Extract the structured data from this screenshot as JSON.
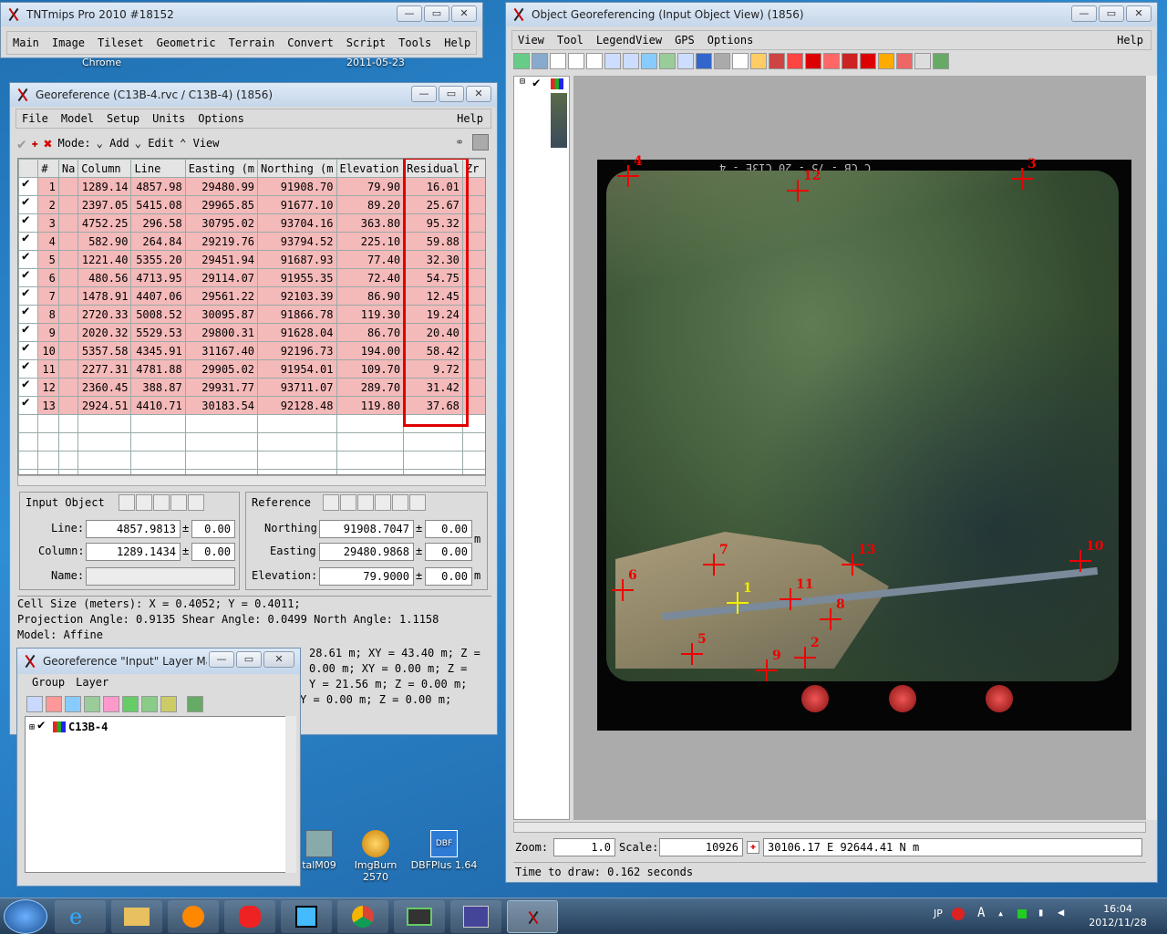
{
  "desktop": {
    "icons": [
      {
        "label": "talM09"
      },
      {
        "label": "ImgBurn 2570"
      },
      {
        "label": "DBFPlus 1.64"
      }
    ],
    "bg_text": [
      "Chrome",
      "2011-05-23"
    ]
  },
  "main_window": {
    "title": "TNTmips Pro 2010  #18152",
    "menus": [
      "Main",
      "Image",
      "Tileset",
      "Geometric",
      "Terrain",
      "Convert",
      "Script",
      "Tools",
      "Help"
    ]
  },
  "georef": {
    "title": "Georeference (C13B-4.rvc / C13B-4) (1856)",
    "menus": [
      "File",
      "Model",
      "Setup",
      "Units",
      "Options"
    ],
    "help": "Help",
    "mode_label": "Mode:",
    "mode_add": "Add",
    "mode_edit": "Edit",
    "mode_view": "View",
    "columns": [
      "#",
      "Na",
      "Column",
      "Line",
      "Easting (m",
      "Northing (m",
      "Elevation",
      "Residual",
      "Zr"
    ],
    "rows": [
      [
        "1",
        "1289.14",
        "4857.98",
        "29480.99",
        "91908.70",
        "79.90",
        "16.01"
      ],
      [
        "2",
        "2397.05",
        "5415.08",
        "29965.85",
        "91677.10",
        "89.20",
        "25.67"
      ],
      [
        "3",
        "4752.25",
        "296.58",
        "30795.02",
        "93704.16",
        "363.80",
        "95.32"
      ],
      [
        "4",
        "582.90",
        "264.84",
        "29219.76",
        "93794.52",
        "225.10",
        "59.88"
      ],
      [
        "5",
        "1221.40",
        "5355.20",
        "29451.94",
        "91687.93",
        "77.40",
        "32.30"
      ],
      [
        "6",
        "480.56",
        "4713.95",
        "29114.07",
        "91955.35",
        "72.40",
        "54.75"
      ],
      [
        "7",
        "1478.91",
        "4407.06",
        "29561.22",
        "92103.39",
        "86.90",
        "12.45"
      ],
      [
        "8",
        "2720.33",
        "5008.52",
        "30095.87",
        "91866.78",
        "119.30",
        "19.24"
      ],
      [
        "9",
        "2020.32",
        "5529.53",
        "29800.31",
        "91628.04",
        "86.70",
        "20.40"
      ],
      [
        "10",
        "5357.58",
        "4345.91",
        "31167.40",
        "92196.73",
        "194.00",
        "58.42"
      ],
      [
        "11",
        "2277.31",
        "4781.88",
        "29905.02",
        "91954.01",
        "109.70",
        "9.72"
      ],
      [
        "12",
        "2360.45",
        "388.87",
        "29931.77",
        "93711.07",
        "289.70",
        "31.42"
      ],
      [
        "13",
        "2924.51",
        "4410.71",
        "30183.54",
        "92128.48",
        "119.80",
        "37.68"
      ]
    ],
    "input": {
      "title": "Input Object",
      "line_label": "Line:",
      "line": "4857.9813",
      "col_label": "Column:",
      "col": "1289.1434",
      "name_label": "Name:",
      "err": "0.00",
      "pm": "±"
    },
    "ref": {
      "title": "Reference",
      "north_label": "Northing",
      "north": "91908.7047",
      "east_label": "Easting",
      "east": "29480.9868",
      "elev_label": "Elevation:",
      "elev": "79.9000",
      "err": "0.00",
      "unit": "m"
    },
    "info": [
      "Cell Size (meters):  X = 0.4052;  Y = 0.4011;",
      "Projection Angle: 0.9135  Shear Angle: 0.0499  North Angle: 1.1158",
      "Model:  Affine"
    ],
    "info_partial": [
      "28.61 m;  XY = 43.40 m;  Z =",
      "0.00 m;  XY = 0.00 m;  Z =",
      "Y = 21.56 m;  Z = 0.00 m;",
      "Y = 0.00 m;  Z = 0.00 m;"
    ]
  },
  "layer_mgr": {
    "title": "Georeference \"Input\" Layer Ma...",
    "menus": [
      "Group",
      "Layer"
    ],
    "layer": "C13B-4"
  },
  "objview": {
    "title": "Object Georeferencing (Input Object View) (1856)",
    "menus": [
      "View",
      "Tool",
      "LegendView",
      "GPS",
      "Options"
    ],
    "help": "Help",
    "photo_text": "C CB - 75 - 20     C13E - 4",
    "zoom_label": "Zoom:",
    "zoom": "1.0",
    "scale_label": "Scale:",
    "scale": "10926",
    "coords": "30106.17 E   92644.41 N m",
    "status": "Time to draw: 0.162 seconds",
    "gcp_labels": [
      "1",
      "2",
      "3",
      "4",
      "5",
      "6",
      "7",
      "8",
      "9",
      "10",
      "11",
      "12",
      "13"
    ]
  },
  "tray": {
    "lang": "JP",
    "time": "16:04",
    "date": "2012/11/28"
  },
  "colors": {
    "residual_box": "#e00000",
    "row_bg": "#f4b9b9",
    "gcp": "#ee0000"
  }
}
